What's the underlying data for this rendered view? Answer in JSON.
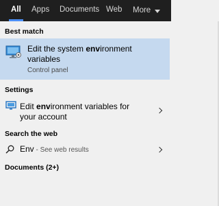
{
  "tabs": [
    {
      "label": "All",
      "active": true
    },
    {
      "label": "Apps",
      "active": false
    },
    {
      "label": "Documents",
      "active": false
    },
    {
      "label": "Web",
      "active": false
    },
    {
      "label": "More",
      "active": false
    }
  ],
  "best_match": {
    "heading": "Best match",
    "title_pre": "Edit the system ",
    "title_bold": "env",
    "title_post": "ironment variables",
    "subtitle": "Control panel",
    "icon": "monitor-settings-icon"
  },
  "settings": {
    "heading": "Settings",
    "item_pre": "Edit ",
    "item_bold": "env",
    "item_post": "ironment variables for your account",
    "icon": "monitor-icon"
  },
  "web": {
    "heading": "Search the web",
    "query": "Env",
    "suffix": " - See web results",
    "icon": "search-icon"
  },
  "documents": {
    "heading": "Documents (2+)"
  },
  "colors": {
    "tabbar_bg": "#1f1f1f",
    "active_underline": "#4b8ef5",
    "highlight_bg": "#c5d9ef",
    "panel_bg": "#f0f0f0"
  }
}
